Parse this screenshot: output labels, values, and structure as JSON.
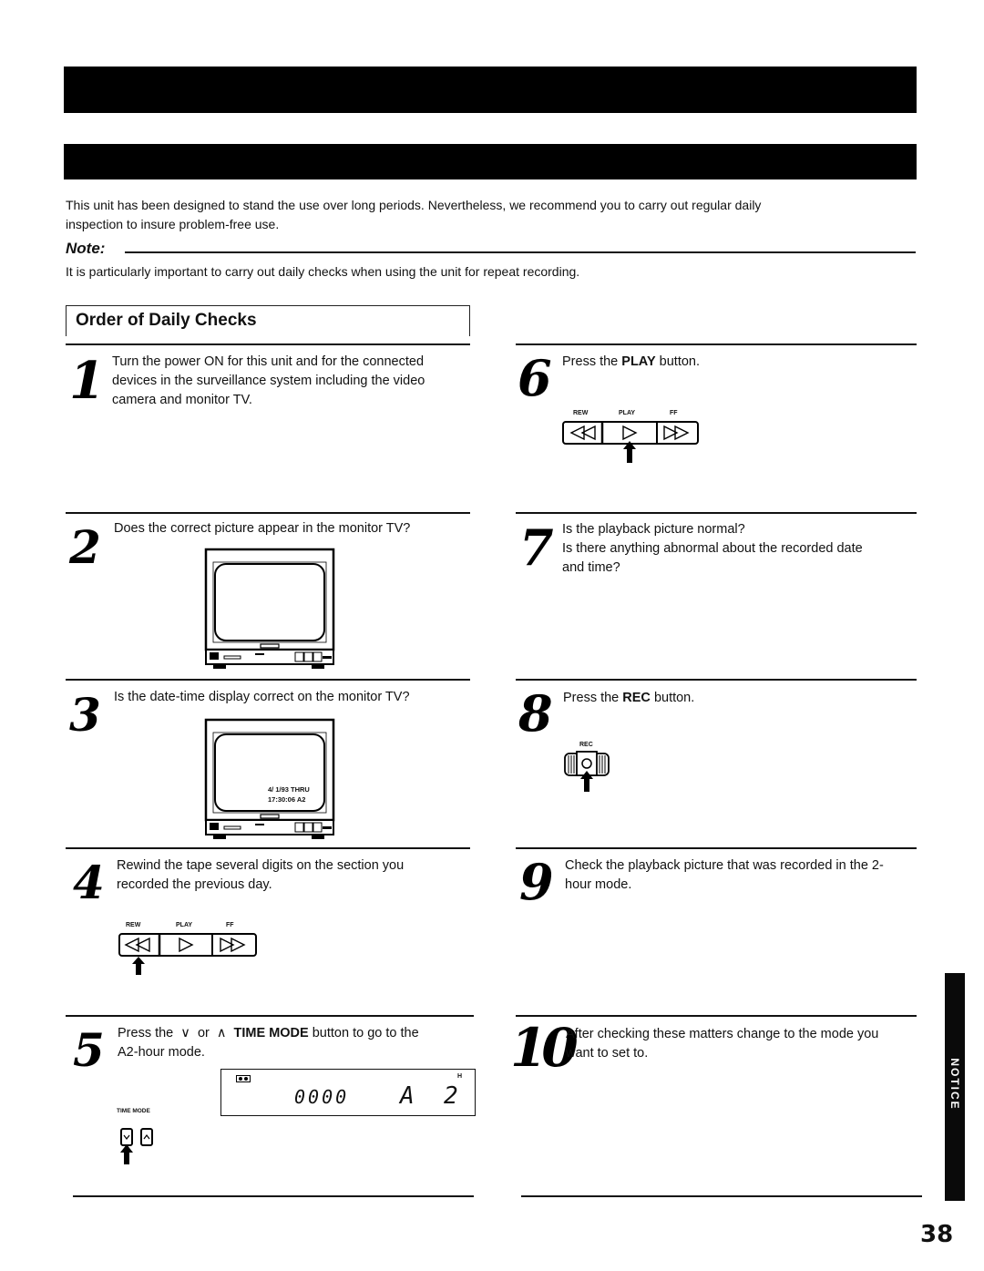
{
  "intro": {
    "line1": "This unit has been designed to stand the use over long periods. Nevertheless, we recommend you to carry out regular daily",
    "line2": "inspection to insure problem-free use."
  },
  "note": {
    "label": "Note:",
    "text": "It is particularly important to carry out daily checks when using the unit for repeat recording."
  },
  "section": {
    "title": "Order of Daily Checks"
  },
  "steps": [
    {
      "num": "1",
      "lines": [
        "Turn the power ON for this unit and for the connected",
        "devices in the surveillance system including the video",
        "camera and monitor TV."
      ]
    },
    {
      "num": "2",
      "text": "Does the correct picture appear in the monitor TV?"
    },
    {
      "num": "3",
      "text": "Is the date-time display correct on the monitor TV?",
      "osd_line1": "4/  1/93 THRU",
      "osd_line2": "17:30:06  A2"
    },
    {
      "num": "4",
      "lines": [
        "Rewind the tape several digits on the section you",
        "recorded the previous day."
      ]
    },
    {
      "num": "5",
      "pre": "Press the",
      "down": "∨",
      "or": "or",
      "up": "∧",
      "bold": "TIME MODE",
      "post": "button to go to the",
      "line2": "A2-hour mode.",
      "display_counter": "0000",
      "display_mode_a": "A",
      "display_mode_num": "2",
      "display_h": "H",
      "button_label": "TIME  MODE"
    },
    {
      "num": "6",
      "pre": "Press the",
      "bold": "PLAY",
      "post": "button."
    },
    {
      "num": "7",
      "lines": [
        "Is the playback picture normal?",
        "Is there anything abnormal about the recorded date",
        "and time?"
      ]
    },
    {
      "num": "8",
      "pre": "Press the",
      "bold": "REC",
      "post": "button.",
      "button_label": "REC"
    },
    {
      "num": "9",
      "lines": [
        "Check the playback picture that was recorded in the 2-",
        "hour mode."
      ]
    },
    {
      "num": "10",
      "lines": [
        "After checking these matters change to the mode you",
        "want to set to."
      ]
    }
  ],
  "transport": {
    "rew": "REW",
    "play": "PLAY",
    "ff": "FF"
  },
  "side_tab": "NOTICE",
  "page_number": "38"
}
